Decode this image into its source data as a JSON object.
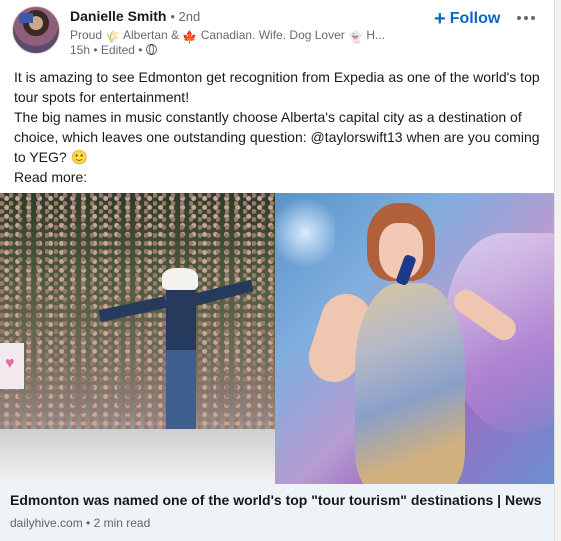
{
  "post": {
    "author": {
      "name": "Danielle Smith",
      "degree": "• 2nd",
      "headline_parts": [
        "Proud",
        "Albertan &",
        "Canadian. Wife. Dog Lover",
        "H..."
      ],
      "headline_icons": [
        "wheat-icon",
        "maple-leaf-icon",
        "ghost-icon"
      ],
      "timestamp": "15h • Edited •",
      "visibility_icon": "globe-icon"
    },
    "follow_label": "Follow",
    "follow_icon": "plus-icon",
    "more_icon": "ellipsis-icon",
    "text": {
      "line1": "It is amazing to see Edmonton get recognition from Expedia as one of the world's top tour spots for entertainment!",
      "line2_prefix": "The big names in music constantly choose Alberta's capital city as a destination of choice, which leaves one outstanding question: @taylorswift13 when are you coming to YEG?",
      "emoji": "🙂",
      "read_more": "Read more:"
    },
    "link": {
      "title": "Edmonton was named one of the world's top \"tour tourism\" destinations | News",
      "source": "dailyhive.com • 2 min read"
    }
  },
  "colors": {
    "accent": "#0a66c2",
    "link_bg": "#eef3f8",
    "secondary_text": "#666666"
  }
}
